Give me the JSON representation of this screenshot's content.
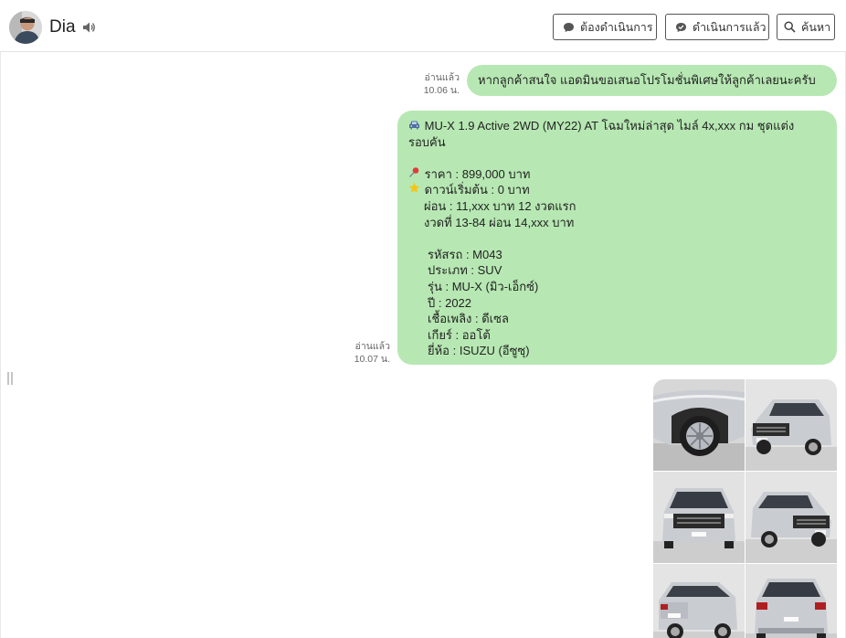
{
  "header": {
    "contact_name": "Dia",
    "buttons": {
      "todo": "ต้องดำเนินการ",
      "done": "ดำเนินการแล้ว",
      "search": "ค้นหา"
    }
  },
  "messages": [
    {
      "status": "อ่านแล้ว",
      "time": "10.06 น.",
      "text": "หากลูกค้าสนใจ แอดมินขอเสนอโปรโมชั่นพิเศษให้ลูกค้าเลยนะครับ"
    },
    {
      "status": "อ่านแล้ว",
      "time": "10.07 น.",
      "lines": [
        "MU-X 1.9 Active 2WD (MY22) AT โฉมใหม่ล่าสุด ไมล์ 4x,xxx กม ชุดแต่ง",
        "รอบคัน",
        "",
        "ราคา : 899,000 บาท",
        "ดาวน์เริ่มต้น : 0 บาท",
        "ผ่อน : 11,xxx บาท 12 งวดแรก",
        "งวดที่ 13-84 ผ่อน 14,xxx บาท",
        "",
        "รหัสรถ : M043",
        "ประเภท : SUV",
        "รุ่น : MU-X (มิว-เอ็กซ์)",
        "ปี : 2022",
        "เชื้อเพลิง : ดีเซล",
        "เกียร์ : ออโต้",
        "ยี่ห้อ : ISUZU (อีซูซุ)"
      ]
    }
  ],
  "gallery": {
    "photos": [
      "front-wheel-closeup",
      "front-right-three-quarter",
      "front-view",
      "front-left-three-quarter",
      "rear-left-three-quarter",
      "rear-view"
    ]
  },
  "colors": {
    "bubble": "#b7e8b3",
    "car_body": "#c9ccd1",
    "header_border": "#e3e3e3"
  }
}
